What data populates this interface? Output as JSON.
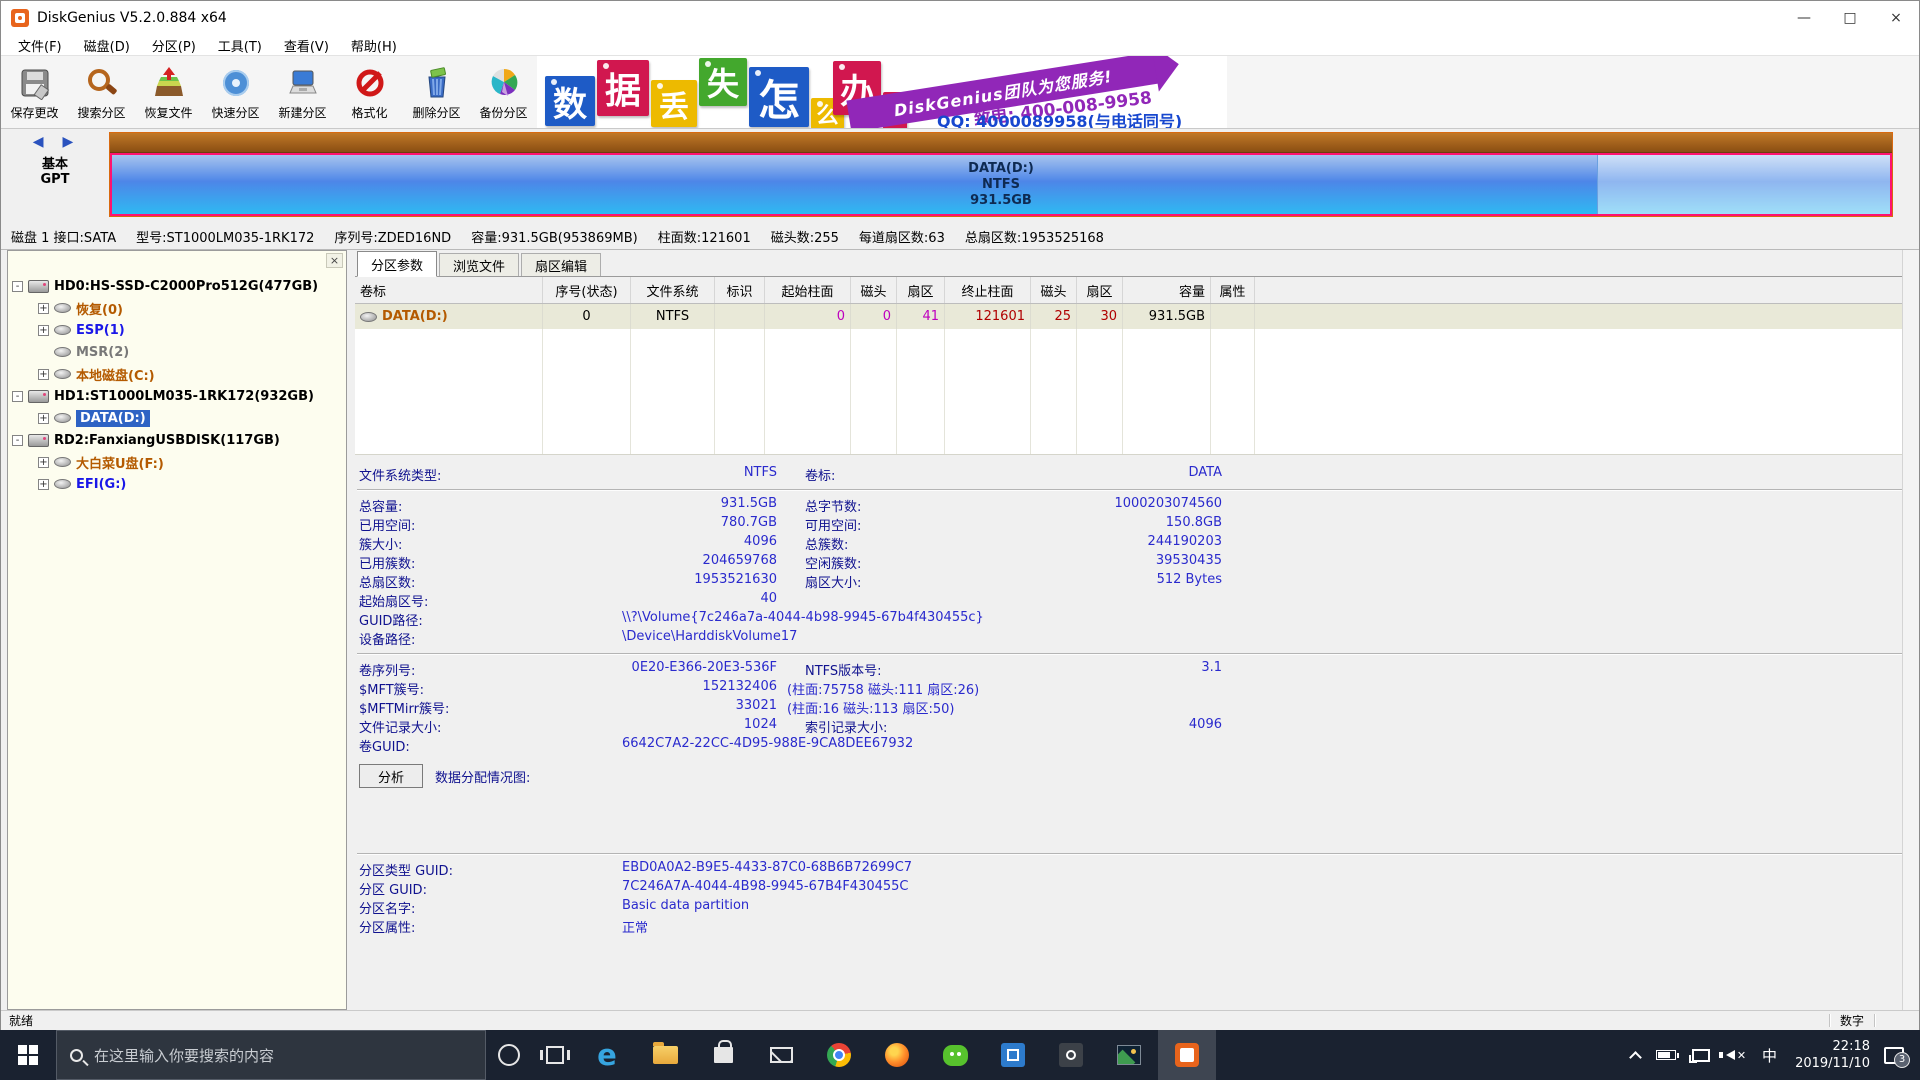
{
  "window": {
    "title": "DiskGenius V5.2.0.884 x64",
    "controls": {
      "minimize": "—",
      "maximize": "□",
      "close": "×"
    }
  },
  "menu": {
    "items": [
      "文件(F)",
      "磁盘(D)",
      "分区(P)",
      "工具(T)",
      "查看(V)",
      "帮助(H)"
    ]
  },
  "toolbar": {
    "buttons": [
      {
        "label": "保存更改"
      },
      {
        "label": "搜索分区"
      },
      {
        "label": "恢复文件"
      },
      {
        "label": "快速分区"
      },
      {
        "label": "新建分区"
      },
      {
        "label": "格式化"
      },
      {
        "label": "删除分区"
      },
      {
        "label": "备份分区"
      }
    ]
  },
  "banner": {
    "tiles": [
      "数",
      "据",
      "丢",
      "失",
      "怎",
      "么",
      "办",
      "!"
    ],
    "ribbon": "DiskGenius团队为您服务!",
    "phone": "致电: 400-008-9958",
    "qq": "QQ: 4000089958(与电话同号)"
  },
  "disk_view": {
    "nav_prev": "◀",
    "nav_next": "▶",
    "type_line1": "基本",
    "type_line2": "GPT",
    "partition": {
      "name": "DATA(D:)",
      "fs": "NTFS",
      "size": "931.5GB"
    }
  },
  "disk_info": {
    "segments": [
      "磁盘 1 接口:SATA",
      "型号:ST1000LM035-1RK172",
      "序列号:ZDED16ND",
      "容量:931.5GB(953869MB)",
      "柱面数:121601",
      "磁头数:255",
      "每道扇区数:63",
      "总扇区数:1953525168"
    ]
  },
  "tree": {
    "close": "×",
    "expander_plus": "+",
    "expander_minus": "-",
    "items": [
      {
        "label": "HD0:HS-SSD-C2000Pro512G(477GB)",
        "type": "disk"
      },
      {
        "label": "恢复(0)",
        "type": "partition",
        "color": "orange"
      },
      {
        "label": "ESP(1)",
        "type": "partition",
        "color": "blue"
      },
      {
        "label": "MSR(2)",
        "type": "partition",
        "color": "gray"
      },
      {
        "label": "本地磁盘(C:)",
        "type": "partition",
        "color": "orange"
      },
      {
        "label": "HD1:ST1000LM035-1RK172(932GB)",
        "type": "disk"
      },
      {
        "label": "DATA(D:)",
        "type": "partition",
        "selected": true
      },
      {
        "label": "RD2:FanxiangUSBDISK(117GB)",
        "type": "disk"
      },
      {
        "label": "大白菜U盘(F:)",
        "type": "partition",
        "color": "orange"
      },
      {
        "label": "EFI(G:)",
        "type": "partition",
        "color": "blue"
      }
    ]
  },
  "tabs": {
    "items": [
      "分区参数",
      "浏览文件",
      "扇区编辑"
    ],
    "active": "分区参数"
  },
  "table": {
    "columns": [
      "卷标",
      "序号(状态)",
      "文件系统",
      "标识",
      "起始柱面",
      "磁头",
      "扇区",
      "终止柱面",
      "磁头",
      "扇区",
      "容量",
      "属性"
    ],
    "row": {
      "volume": "DATA(D:)",
      "index": "0",
      "fs": "NTFS",
      "flag": "",
      "start_cyl": "0",
      "start_head": "0",
      "start_sec": "41",
      "end_cyl": "121601",
      "end_head": "25",
      "end_sec": "30",
      "capacity": "931.5GB",
      "attr": ""
    }
  },
  "details": {
    "fs_row": {
      "l": "文件系统类型:",
      "v": "NTFS",
      "l2": "卷标:",
      "v2": "DATA"
    },
    "usage": [
      {
        "l": "总容量:",
        "v": "931.5GB",
        "l2": "总字节数:",
        "v2": "1000203074560"
      },
      {
        "l": "已用空间:",
        "v": "780.7GB",
        "l2": "可用空间:",
        "v2": "150.8GB"
      },
      {
        "l": "簇大小:",
        "v": "4096",
        "l2": "总簇数:",
        "v2": "244190203"
      },
      {
        "l": "已用簇数:",
        "v": "204659768",
        "l2": "空闲簇数:",
        "v2": "39530435"
      },
      {
        "l": "总扇区数:",
        "v": "1953521630",
        "l2": "扇区大小:",
        "v2": "512 Bytes"
      },
      {
        "l": "起始扇区号:",
        "v": "40"
      }
    ],
    "paths": [
      {
        "l": "GUID路径:",
        "v": "\\\\?\\Volume{7c246a7a-4044-4b98-9945-67b4f430455c}"
      },
      {
        "l": "设备路径:",
        "v": "\\Device\\HarddiskVolume17"
      }
    ],
    "ntfs": [
      {
        "l": "卷序列号:",
        "v": "0E20-E366-20E3-536F",
        "l2": "NTFS版本号:",
        "v2": "3.1"
      },
      {
        "l": "$MFT簇号:",
        "v": "152132406",
        "ext": "(柱面:75758 磁头:111 扇区:26)"
      },
      {
        "l": "$MFTMirr簇号:",
        "v": "33021",
        "ext": "(柱面:16 磁头:113 扇区:50)"
      },
      {
        "l": "文件记录大小:",
        "v": "1024",
        "l2": "索引记录大小:",
        "v2": "4096"
      },
      {
        "l": "卷GUID:",
        "v": "6642C7A2-22CC-4D95-988E-9CA8DEE67932"
      }
    ],
    "analyze": {
      "button": "分析",
      "label": "数据分配情况图:"
    },
    "guid": [
      {
        "l": "分区类型 GUID:",
        "v": "EBD0A0A2-B9E5-4433-87C0-68B6B72699C7"
      },
      {
        "l": "分区 GUID:",
        "v": "7C246A7A-4044-4B98-9945-67B4F430455C"
      },
      {
        "l": "分区名字:",
        "v": "Basic data partition"
      },
      {
        "l": "分区属性:",
        "v": "正常"
      }
    ]
  },
  "statusbar": {
    "left": "就绪",
    "right": "数字"
  },
  "taskbar": {
    "search_placeholder": "在这里输入你要搜索的内容",
    "apps": [
      "cortana",
      "task-view",
      "edge",
      "file-explorer",
      "store",
      "mail",
      "chrome",
      "firefox",
      "wechat",
      "app-blue",
      "app-dark",
      "photos",
      "diskgenius"
    ],
    "active_app": "diskgenius",
    "tray": {
      "ime": "中",
      "time": "22:18",
      "date": "2019/11/10",
      "badge": "3"
    }
  },
  "colors": {
    "selection_blue": "#2E63C4",
    "detail_label": "#10128F",
    "detail_value": "#2A2ACD",
    "start_chs_magenta": "#BE00BE",
    "end_chs_red": "#B00000",
    "orange_text": "#B45A00",
    "blue_text": "#1A17E8",
    "banner_purple": "#9127B8",
    "qq_blue": "#1747CF",
    "taskbar_bg": "#1A2230",
    "partition_border": "#FF1270"
  }
}
